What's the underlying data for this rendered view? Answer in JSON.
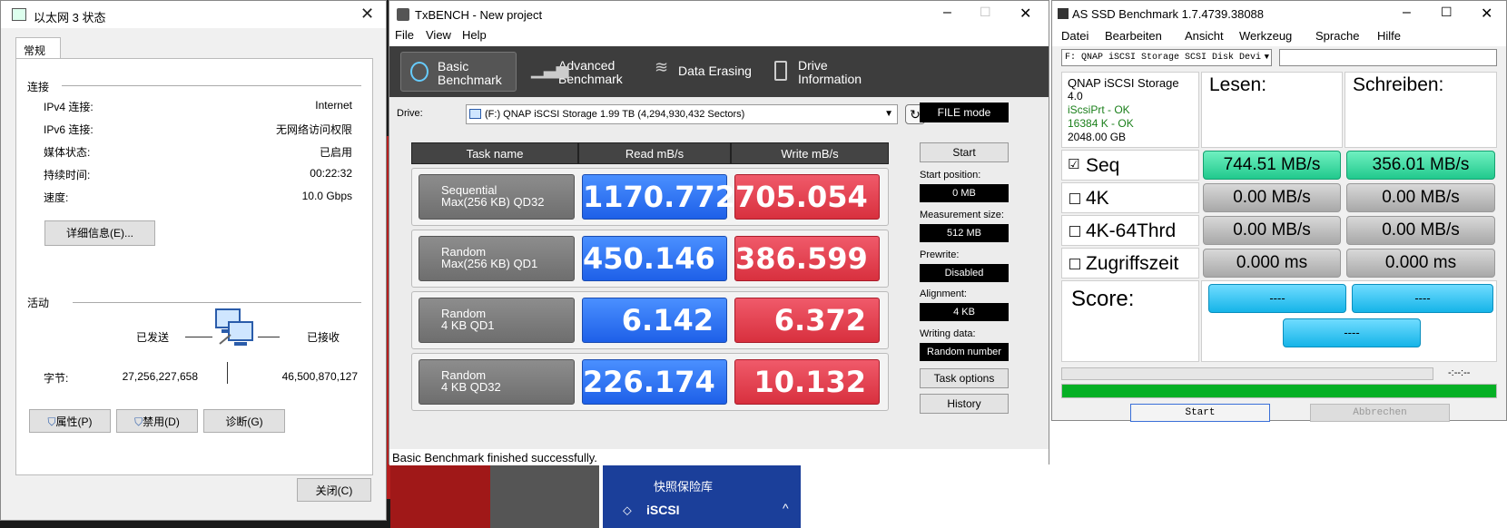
{
  "net_dialog": {
    "title": "以太网 3 状态",
    "tab": "常规",
    "connection_header": "连接",
    "rows": [
      {
        "label": "IPv4 连接:",
        "value": "Internet"
      },
      {
        "label": "IPv6 连接:",
        "value": "无网络访问权限"
      },
      {
        "label": "媒体状态:",
        "value": "已启用"
      },
      {
        "label": "持续时间:",
        "value": "00:22:32"
      },
      {
        "label": "速度:",
        "value": "10.0 Gbps"
      }
    ],
    "details_button": "详细信息(E)...",
    "activity_header": "活动",
    "sent_label": "已发送",
    "received_label": "已接收",
    "bytes_label": "字节:",
    "bytes_sent": "27,256,227,658",
    "bytes_received": "46,500,870,127",
    "properties_button": "属性(P)",
    "disable_button": "禁用(D)",
    "diagnose_button": "诊断(G)",
    "close_button": "关闭(C)"
  },
  "txbench": {
    "title": "TxBENCH - New project",
    "menu": [
      "File",
      "View",
      "Help"
    ],
    "toolbar": [
      {
        "line1": "Basic",
        "line2": "Benchmark",
        "active": true
      },
      {
        "line1": "Advanced",
        "line2": "Benchmark",
        "active": false
      },
      {
        "line1": "Data Erasing",
        "line2": "",
        "active": false
      },
      {
        "line1": "Drive",
        "line2": "Information",
        "active": false
      }
    ],
    "drive_label": "Drive:",
    "drive_value": "(F:) QNAP iSCSI Storage  1.99 TB (4,294,930,432 Sectors)",
    "mode_button": "FILE mode",
    "col_task": "Task name",
    "col_read": "Read mB/s",
    "col_write": "Write mB/s",
    "results": [
      {
        "task1": "Sequential",
        "task2": "Max(256 KB) QD32",
        "read": "1170.772",
        "write": "705.054"
      },
      {
        "task1": "Random",
        "task2": "Max(256 KB) QD1",
        "read": "450.146",
        "write": "386.599"
      },
      {
        "task1": "Random",
        "task2": "4 KB QD1",
        "read": "6.142",
        "write": "6.372"
      },
      {
        "task1": "Random",
        "task2": "4 KB QD32",
        "read": "226.174",
        "write": "10.132"
      }
    ],
    "start_button": "Start",
    "start_position_label": "Start position:",
    "start_position_value": "0 MB",
    "measurement_size_label": "Measurement size:",
    "measurement_size_value": "512 MB",
    "prewrite_label": "Prewrite:",
    "prewrite_value": "Disabled",
    "alignment_label": "Alignment:",
    "alignment_value": "4 KB",
    "writing_data_label": "Writing data:",
    "writing_data_value": "Random number",
    "task_options_button": "Task options",
    "history_button": "History",
    "status": "Basic Benchmark finished successfully."
  },
  "asssd": {
    "title": "AS SSD Benchmark 1.7.4739.38088",
    "menu": [
      "Datei",
      "Bearbeiten",
      "Ansicht",
      "Werkzeug",
      "Sprache",
      "Hilfe"
    ],
    "drive_select": "F: QNAP iSCSI Storage SCSI Disk Devi",
    "info": [
      "QNAP iSCSI Storage",
      "4.0",
      "iScsiPrt - OK",
      "16384 K - OK",
      "2048.00 GB"
    ],
    "read_header": "Lesen:",
    "write_header": "Schreiben:",
    "tests": [
      {
        "name": "Seq",
        "checked": true,
        "read": "744.51 MB/s",
        "write": "356.01 MB/s"
      },
      {
        "name": "4K",
        "checked": false,
        "read": "0.00 MB/s",
        "write": "0.00 MB/s"
      },
      {
        "name": "4K-64Thrd",
        "checked": false,
        "read": "0.00 MB/s",
        "write": "0.00 MB/s"
      },
      {
        "name": "Zugriffszeit",
        "checked": false,
        "read": "0.000 ms",
        "write": "0.000 ms"
      }
    ],
    "checkmark": "☑",
    "score_label": "Score:",
    "score_read": "----",
    "score_write": "----",
    "score_total": "----",
    "time_display": "-:--:--",
    "progress": 1.0,
    "start_button": "Start",
    "cancel_button": "Abbrechen"
  },
  "background": {
    "panel_title": "快照保险库",
    "iscsi_label": "iSCSI"
  }
}
